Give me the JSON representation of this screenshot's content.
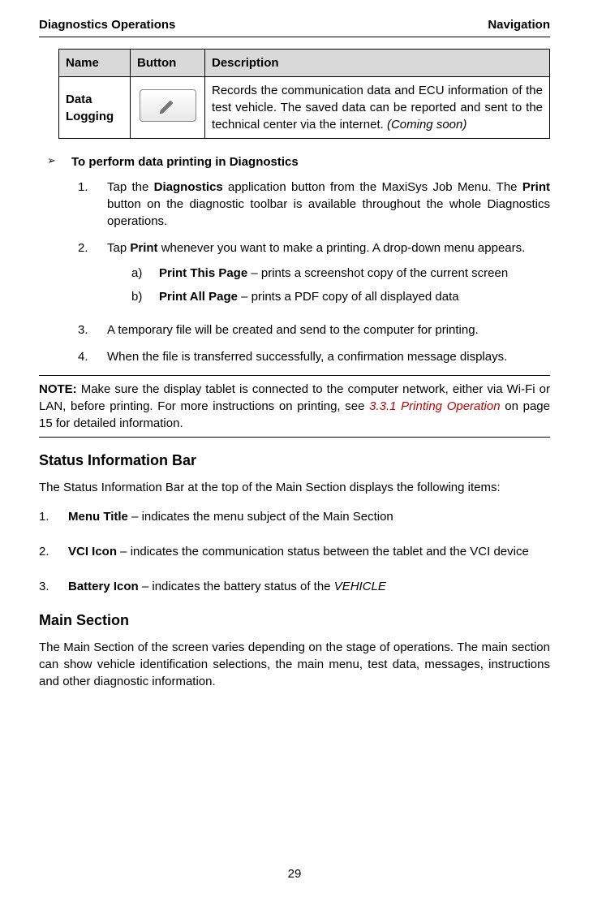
{
  "header": {
    "left": "Diagnostics Operations",
    "right": "Navigation"
  },
  "table": {
    "headers": [
      "Name",
      "Button",
      "Description"
    ],
    "row": {
      "name": "Data Logging",
      "description_parts": {
        "p1": "Records the communication data and ECU information of the test vehicle. The saved data can be reported and sent to the technical center via the internet. ",
        "p2": "(Coming soon)"
      }
    }
  },
  "procedure": {
    "title": "To perform data printing in Diagnostics",
    "steps": {
      "s1": {
        "pre": "Tap the ",
        "b1": "Diagnostics",
        "mid": " application button from the MaxiSys Job Menu. The ",
        "b2": "Print",
        "post": " button on the diagnostic toolbar is available throughout the whole Diagnostics operations."
      },
      "s2": {
        "pre": "Tap ",
        "b1": "Print",
        "post": " whenever you want to make a printing. A drop-down menu appears.",
        "sub": {
          "a": {
            "b": "Print This Page",
            "t": " – prints a screenshot copy of the current screen"
          },
          "b": {
            "b": "Print All Page",
            "t": " – prints a PDF copy of all displayed data"
          }
        }
      },
      "s3": "A temporary file will be created and send to the computer for printing.",
      "s4": "When the file is transferred successfully, a confirmation message displays."
    }
  },
  "note": {
    "label": "NOTE:",
    "pre": " Make sure the display tablet is connected to the computer network, either via Wi-Fi or LAN, before printing. For more instructions on printing, see ",
    "link": "3.3.1 Printing Operation",
    "post": " on page 15 for detailed information."
  },
  "status_bar": {
    "heading": "Status Information Bar",
    "intro": "The Status Information Bar at the top of the Main Section displays the following items:",
    "items": {
      "i1": {
        "b": "Menu Title",
        "t": " – indicates the menu subject of the Main Section"
      },
      "i2": {
        "b": "VCI Icon",
        "t": " – indicates the communication status between the tablet and the VCI device"
      },
      "i3": {
        "b": "Battery Icon",
        "t1": " – indicates the battery status of the ",
        "it": "VEHICLE"
      }
    }
  },
  "main_section": {
    "heading": "Main Section",
    "body": "The Main Section of the screen varies depending on the stage of operations. The main section can show vehicle identification selections, the main menu, test data, messages, instructions and other diagnostic information."
  },
  "page_number": "29"
}
